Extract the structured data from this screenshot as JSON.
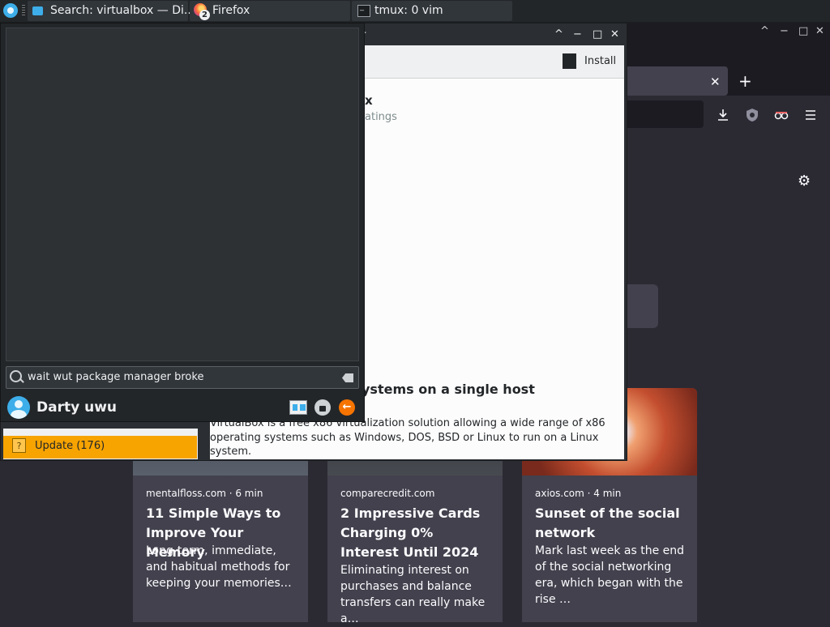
{
  "taskbar": {
    "tasks": [
      {
        "label": "Search: virtualbox — Di..."
      },
      {
        "label": "Firefox",
        "badge": "2"
      },
      {
        "label": "tmux: 0 vim"
      }
    ]
  },
  "firefox": {
    "window_controls": [
      "^",
      "−",
      "□",
      "✕"
    ],
    "tab_close": "✕",
    "new_tab": "+",
    "settings_icon": "gear-icon",
    "cards": [
      {
        "source": "mentalfloss.com · 6 min",
        "title": "11 Simple Ways to Improve Your Memory",
        "excerpt": "Long-term, immediate, and habitual methods for keeping your memories…"
      },
      {
        "source": "comparecredit.com",
        "title": "2 Impressive Cards Charging 0% Interest Until 2024",
        "excerpt": "Eliminating interest on purchases and balance transfers can really make a…"
      },
      {
        "source": "axios.com · 4 min",
        "title": "Sunset of the social network",
        "excerpt": "Mark last week as the end of the social networking era, which began with the rise …"
      }
    ]
  },
  "software_center": {
    "title_fragment": "r",
    "window_controls": [
      "^",
      "−",
      "□",
      "✕"
    ],
    "install_label": "Install",
    "app_name_fragment": "x",
    "ratings_fragment": "atings",
    "headline_fragment": "ystems on a single host",
    "description": "VirtualBox is a free x86 virtualization solution allowing a wide range of x86 operating systems such as Windows, DOS, BSD or Linux to run on a Linux system.",
    "update_label": "Update (176)",
    "update_icon": "?"
  },
  "launcher": {
    "search_text": "wait wut package manager broke",
    "user_name": "Darty uwu",
    "leave_icon": "←"
  },
  "colors": {
    "accent": "#3daee9",
    "update_highlight": "#f7a300",
    "leave_button": "#f67400"
  }
}
